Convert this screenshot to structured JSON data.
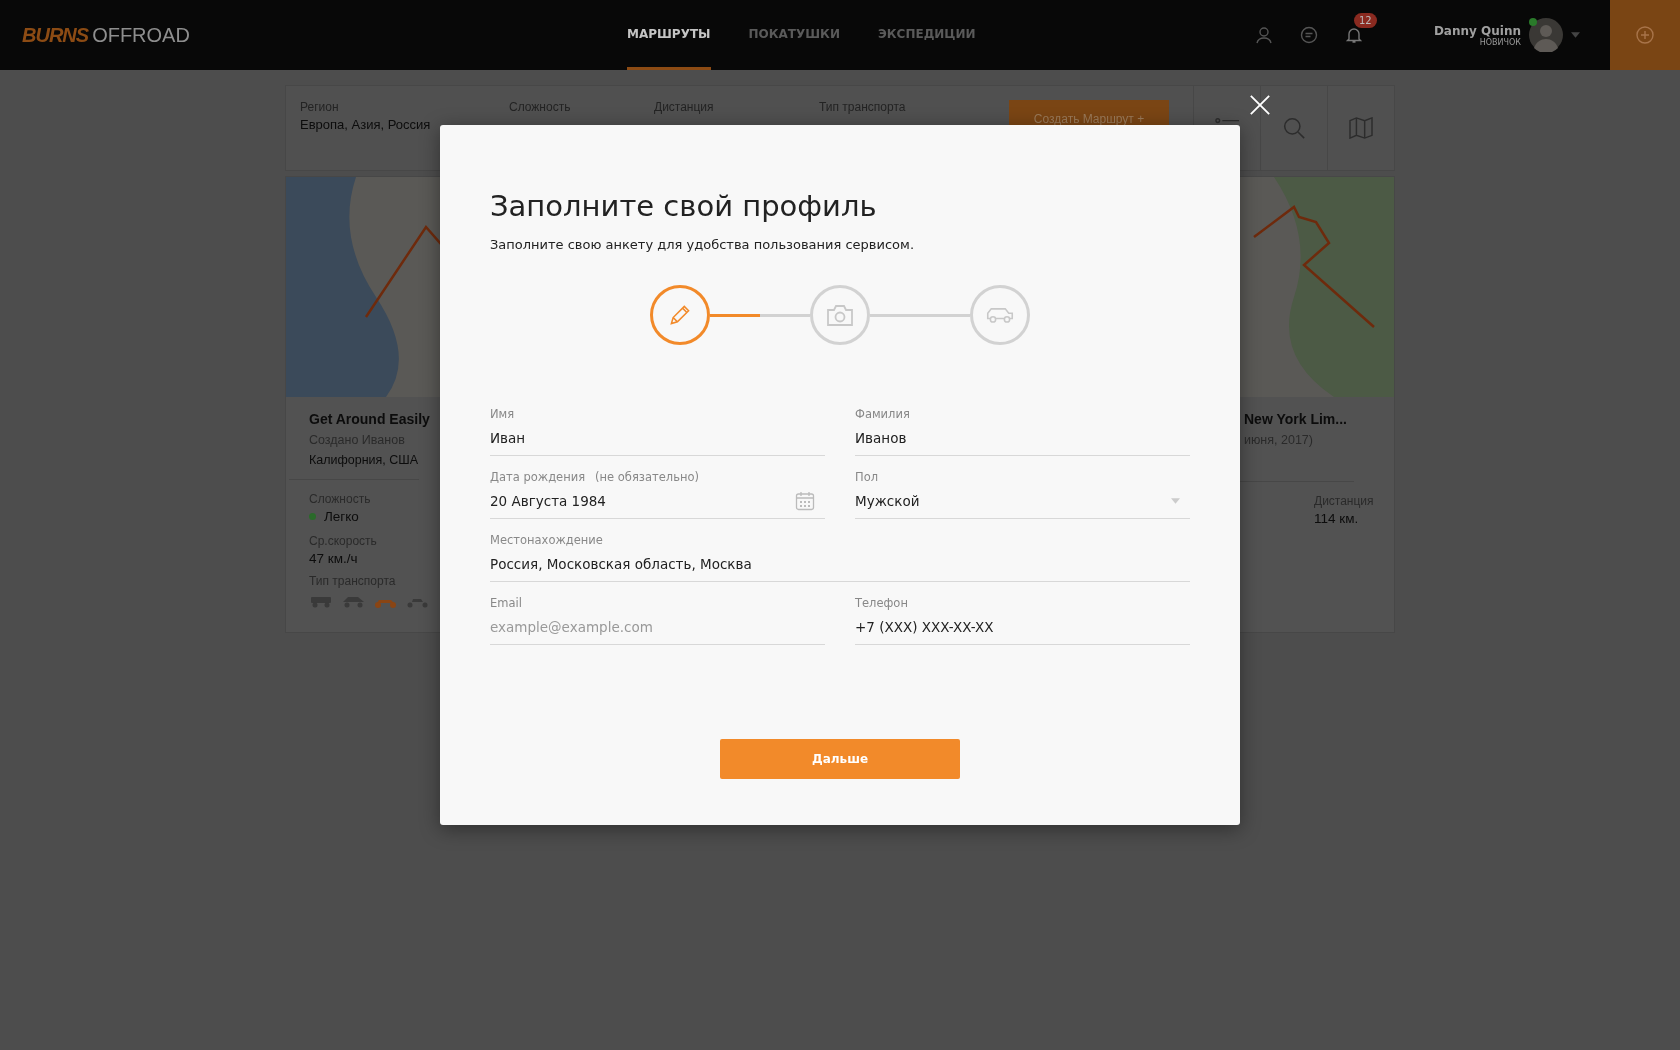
{
  "header": {
    "logo": {
      "brand": "BURNS",
      "suffix": "OFFROAD"
    },
    "nav": [
      {
        "label": "МАРШРУТЫ",
        "selected": true
      },
      {
        "label": "ПОКАТУШКИ",
        "selected": false
      },
      {
        "label": "ЭКСПЕДИЦИИ",
        "selected": false
      }
    ],
    "notifications_count": "12",
    "user": {
      "name": "Danny Quinn",
      "rank": "НОВИЧОК",
      "online": true
    }
  },
  "filters": {
    "fields": [
      {
        "label": "Регион",
        "value": "Европа, Азия, Россия"
      },
      {
        "label": "Сложность"
      },
      {
        "label": "Дистанция"
      },
      {
        "label": "Тип транспорта"
      }
    ],
    "create_button": "Создать Маршрут +",
    "views": [
      {
        "kind": "list"
      },
      {
        "kind": "search"
      },
      {
        "kind": "map"
      }
    ]
  },
  "route_cards": [
    {
      "kind": "left",
      "title": "Get Around Easily",
      "author": "Создано Иванов",
      "location": "Калифорния, США",
      "stats": [
        {
          "label": "Сложность",
          "value": "Легко",
          "color": "#2a6a2a"
        },
        {
          "label": "Ср.скорость",
          "value": "47 км./ч"
        }
      ],
      "transport_label": "Тип транспорта",
      "transport": [
        {
          "kind": "jeep",
          "selected": false
        },
        {
          "kind": "buggy",
          "selected": false
        },
        {
          "kind": "motorcycle",
          "selected": true
        },
        {
          "kind": "dirtbike",
          "selected": false
        }
      ]
    },
    {
      "kind": "right",
      "title": "New York Lim...",
      "date": "июня, 2017)",
      "stats": [
        {
          "label": "Дистанция",
          "value": "114 км."
        }
      ]
    }
  ],
  "modal": {
    "title": "Заполните свой профиль",
    "subtitle": "Заполните свою анкету для удобства пользования сервисом.",
    "steps": [
      {
        "selected": true
      },
      {
        "selected": false
      },
      {
        "selected": false
      }
    ],
    "connectors": [
      {
        "level": 0.5
      }
    ],
    "fields": [
      {
        "kind": "text",
        "label": "Имя",
        "value": "Иван"
      },
      {
        "kind": "text",
        "label": "Фамилия",
        "value": "Иванов"
      },
      {
        "kind": "date",
        "label": "Дата рождения",
        "note": "(не обязательно)",
        "value": "20 Августа 1984"
      },
      {
        "kind": "select",
        "label": "Пол",
        "value": "Мужской"
      },
      {
        "kind": "wide",
        "label": "Местонахождение",
        "value": "Россия, Московская область, Москва"
      },
      {
        "kind": "text",
        "label": "Email",
        "placeholder": "example@example.com"
      },
      {
        "kind": "text",
        "label": "Телефон",
        "value": "+7 (XXX) XXX-XX-XX"
      }
    ],
    "next_button": "Дальше"
  }
}
